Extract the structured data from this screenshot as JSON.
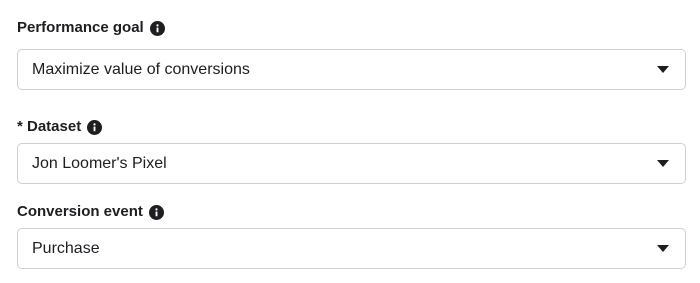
{
  "performance_goal": {
    "label": "Performance goal",
    "value": "Maximize value of conversions",
    "info_icon": "info-icon",
    "dropdown_icon": "caret-down-icon"
  },
  "dataset": {
    "label": "* Dataset",
    "value": "Jon Loomer's Pixel",
    "info_icon": "info-icon",
    "dropdown_icon": "caret-down-icon"
  },
  "conversion_event": {
    "label": "Conversion event",
    "value": "Purchase",
    "info_icon": "info-icon",
    "dropdown_icon": "caret-down-icon"
  },
  "colors": {
    "text": "#1c1e21",
    "border": "#ccd0d5",
    "background": "#ffffff"
  }
}
